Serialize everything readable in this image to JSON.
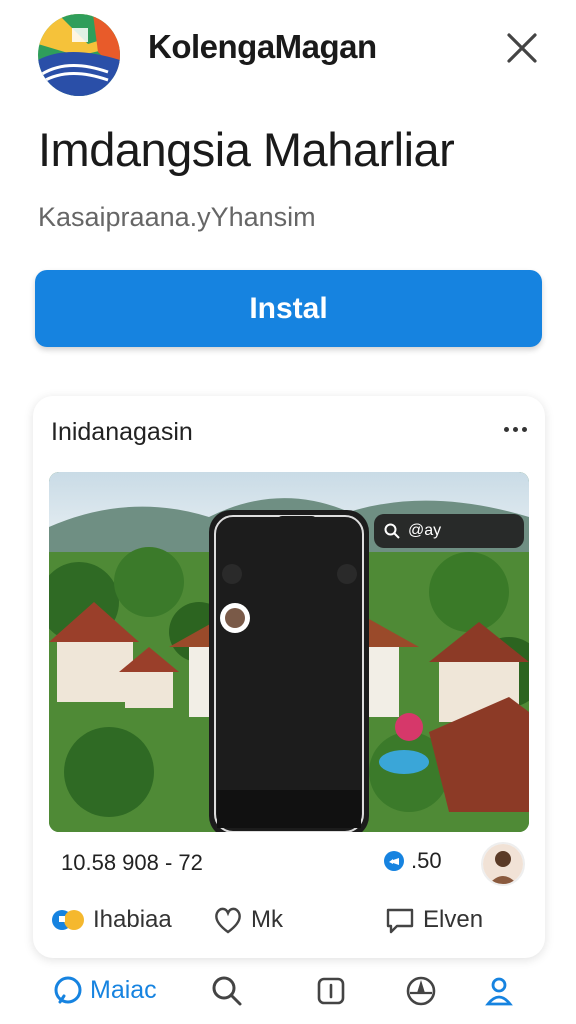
{
  "header": {
    "app_name": "KolengaMagan",
    "close_icon": "close-icon"
  },
  "title": "Imdangsia Maharliar",
  "subtitle": "Kasaipraana.yYhansim",
  "install_label": "Instal",
  "card": {
    "title": "Inidanagasin",
    "more_icon": "more-horizontal-icon",
    "phone_mock": {
      "search_icon": "search-icon",
      "search_text": "@ay"
    },
    "stats": {
      "left": "10.58  908 - 72",
      "right_count": ".50"
    },
    "actions": [
      {
        "label": "Ihabiaa",
        "icon": "reaction-icon"
      },
      {
        "label": "Mk",
        "icon": "heart-icon"
      },
      {
        "label": "Elven",
        "icon": "comment-icon"
      }
    ]
  },
  "tabbar": {
    "items": [
      {
        "label": "Maiac",
        "icon": "home-icon",
        "active": true
      },
      {
        "label": "",
        "icon": "search-icon"
      },
      {
        "label": "",
        "icon": "square-icon"
      },
      {
        "label": "",
        "icon": "compass-icon"
      },
      {
        "label": "",
        "icon": "profile-icon"
      }
    ]
  },
  "colors": {
    "accent": "#1683e0",
    "text": "#1a1a1a",
    "subtext": "#666666"
  }
}
